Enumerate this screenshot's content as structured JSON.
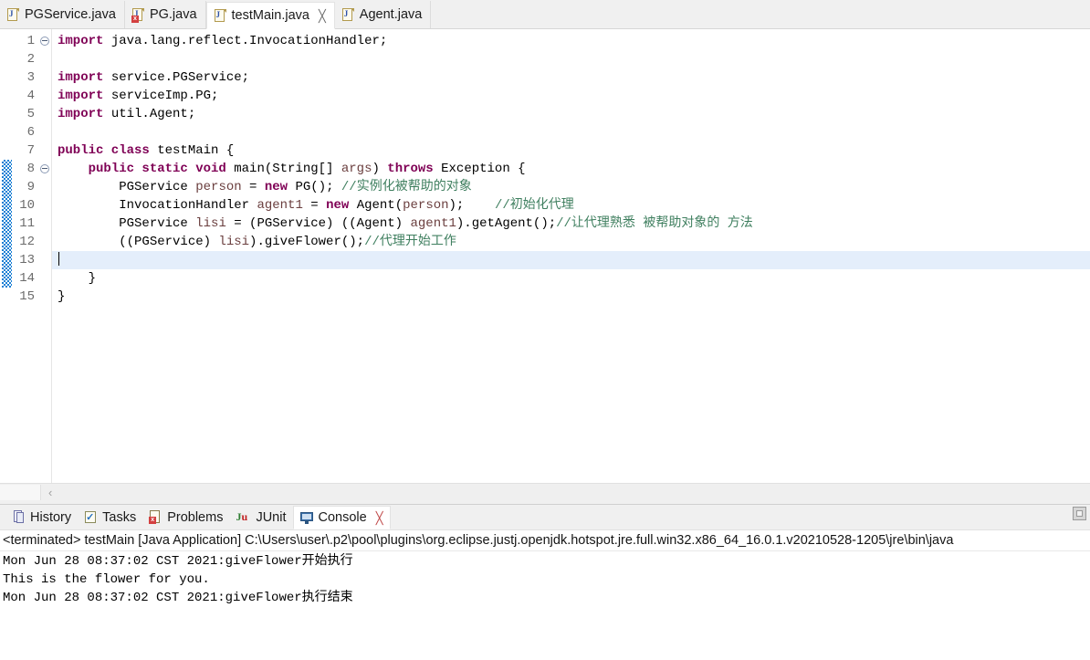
{
  "editor_tabs": [
    {
      "label": "PGService.java",
      "icon": "java-file-icon",
      "active": false,
      "closable": false
    },
    {
      "label": "PG.java",
      "icon": "java-file-error-icon",
      "active": false,
      "closable": false
    },
    {
      "label": "testMain.java",
      "icon": "java-file-icon",
      "active": true,
      "closable": true,
      "close_glyph": "╳"
    },
    {
      "label": "Agent.java",
      "icon": "java-file-icon",
      "active": false,
      "closable": false
    }
  ],
  "editor": {
    "lines": [
      {
        "num": "1",
        "fold": true,
        "changed": false,
        "current": false,
        "tokens": [
          {
            "t": "kw",
            "v": "import"
          },
          {
            "t": "pln",
            "v": " java.lang.reflect.InvocationHandler;"
          }
        ]
      },
      {
        "num": "2",
        "fold": false,
        "changed": false,
        "current": false,
        "tokens": []
      },
      {
        "num": "3",
        "fold": false,
        "changed": false,
        "current": false,
        "tokens": [
          {
            "t": "kw",
            "v": "import"
          },
          {
            "t": "pln",
            "v": " service.PGService;"
          }
        ]
      },
      {
        "num": "4",
        "fold": false,
        "changed": false,
        "current": false,
        "tokens": [
          {
            "t": "kw",
            "v": "import"
          },
          {
            "t": "pln",
            "v": " serviceImp.PG;"
          }
        ]
      },
      {
        "num": "5",
        "fold": false,
        "changed": false,
        "current": false,
        "tokens": [
          {
            "t": "kw",
            "v": "import"
          },
          {
            "t": "pln",
            "v": " util.Agent;"
          }
        ]
      },
      {
        "num": "6",
        "fold": false,
        "changed": false,
        "current": false,
        "tokens": []
      },
      {
        "num": "7",
        "fold": false,
        "changed": false,
        "current": false,
        "tokens": [
          {
            "t": "kw",
            "v": "public class"
          },
          {
            "t": "pln",
            "v": " testMain {"
          }
        ]
      },
      {
        "num": "8",
        "fold": true,
        "changed": true,
        "current": false,
        "tokens": [
          {
            "t": "pln",
            "v": "    "
          },
          {
            "t": "kw",
            "v": "public static void"
          },
          {
            "t": "pln",
            "v": " main(String[] "
          },
          {
            "t": "var",
            "v": "args"
          },
          {
            "t": "pln",
            "v": ") "
          },
          {
            "t": "kw",
            "v": "throws"
          },
          {
            "t": "pln",
            "v": " Exception {"
          }
        ]
      },
      {
        "num": "9",
        "fold": false,
        "changed": true,
        "current": false,
        "tokens": [
          {
            "t": "pln",
            "v": "        PGService "
          },
          {
            "t": "var",
            "v": "person"
          },
          {
            "t": "pln",
            "v": " = "
          },
          {
            "t": "kw",
            "v": "new"
          },
          {
            "t": "pln",
            "v": " PG(); "
          },
          {
            "t": "cmt",
            "v": "//实例化被帮助的对象"
          }
        ]
      },
      {
        "num": "10",
        "fold": false,
        "changed": true,
        "current": false,
        "tokens": [
          {
            "t": "pln",
            "v": "        InvocationHandler "
          },
          {
            "t": "var",
            "v": "agent1"
          },
          {
            "t": "pln",
            "v": " = "
          },
          {
            "t": "kw",
            "v": "new"
          },
          {
            "t": "pln",
            "v": " Agent("
          },
          {
            "t": "var",
            "v": "person"
          },
          {
            "t": "pln",
            "v": ");    "
          },
          {
            "t": "cmt",
            "v": "//初始化代理"
          }
        ]
      },
      {
        "num": "11",
        "fold": false,
        "changed": true,
        "current": false,
        "tokens": [
          {
            "t": "pln",
            "v": "        PGService "
          },
          {
            "t": "var",
            "v": "lisi"
          },
          {
            "t": "pln",
            "v": " = (PGService) ((Agent) "
          },
          {
            "t": "var",
            "v": "agent1"
          },
          {
            "t": "pln",
            "v": ").getAgent();"
          },
          {
            "t": "cmt",
            "v": "//让代理熟悉 被帮助对象的 方法"
          }
        ]
      },
      {
        "num": "12",
        "fold": false,
        "changed": true,
        "current": false,
        "tokens": [
          {
            "t": "pln",
            "v": "        ((PGService) "
          },
          {
            "t": "var",
            "v": "lisi"
          },
          {
            "t": "pln",
            "v": ").giveFlower();"
          },
          {
            "t": "cmt",
            "v": "//代理开始工作"
          }
        ]
      },
      {
        "num": "13",
        "fold": false,
        "changed": true,
        "current": true,
        "tokens": []
      },
      {
        "num": "14",
        "fold": false,
        "changed": true,
        "current": false,
        "tokens": [
          {
            "t": "pln",
            "v": "    }"
          }
        ]
      },
      {
        "num": "15",
        "fold": false,
        "changed": false,
        "current": false,
        "tokens": [
          {
            "t": "pln",
            "v": "}"
          }
        ]
      }
    ],
    "hscroll_arrow": "‹"
  },
  "view_tabs": [
    {
      "label": "History",
      "icon": "history-icon",
      "active": false,
      "closable": false
    },
    {
      "label": "Tasks",
      "icon": "tasks-icon",
      "active": false,
      "closable": false
    },
    {
      "label": "Problems",
      "icon": "problems-icon",
      "active": false,
      "closable": false
    },
    {
      "label": "JUnit",
      "icon": "junit-icon",
      "active": false,
      "closable": false
    },
    {
      "label": "Console",
      "icon": "console-icon",
      "active": true,
      "closable": true,
      "close_glyph": "╳"
    }
  ],
  "console": {
    "header": "<terminated> testMain [Java Application] C:\\Users\\user\\.p2\\pool\\plugins\\org.eclipse.justj.openjdk.hotspot.jre.full.win32.x86_64_16.0.1.v20210528-1205\\jre\\bin\\java",
    "output": "Mon Jun 28 08:37:02 CST 2021:giveFlower开始执行\nThis is the flower for you.\nMon Jun 28 08:37:02 CST 2021:giveFlower执行结束"
  },
  "colors": {
    "keyword": "#7f0055",
    "comment": "#3f7f5f",
    "local_var": "#6a3e3e",
    "current_line": "#e4eefb",
    "change_bar": "#1a7fd4"
  }
}
